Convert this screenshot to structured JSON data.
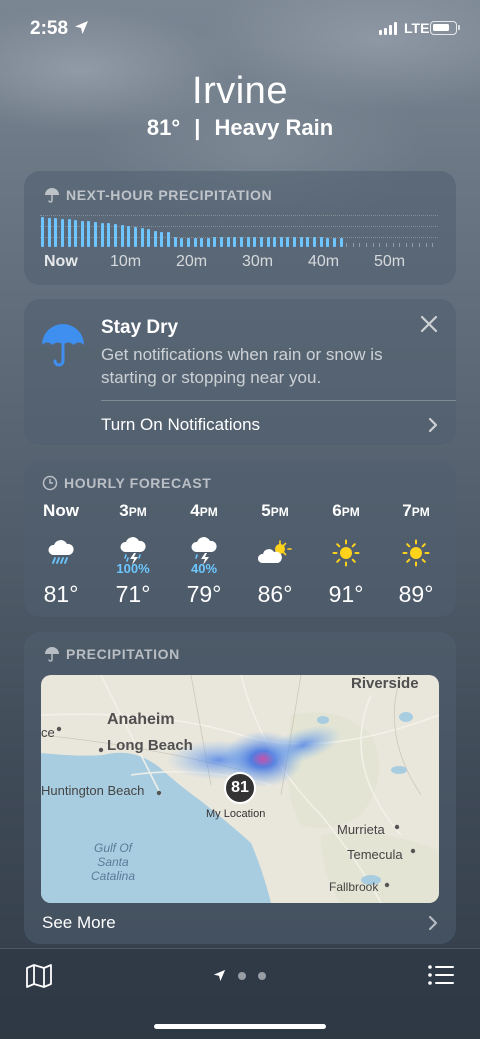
{
  "status": {
    "time": "2:58",
    "network": "LTE",
    "signal_bars": 4
  },
  "header": {
    "city": "Irvine",
    "temperature": "81°",
    "separator": "|",
    "condition": "Heavy Rain"
  },
  "precipitation_next_hour": {
    "title": "NEXT-HOUR PRECIPITATION",
    "axis_labels": [
      "Now",
      "10m",
      "20m",
      "30m",
      "40m",
      "50m"
    ],
    "chart_data": {
      "type": "bar",
      "x": [
        0,
        1,
        2,
        3,
        4,
        5,
        6,
        7,
        8,
        9,
        10,
        11,
        12,
        13,
        14,
        15,
        16,
        17,
        18,
        19,
        20,
        21,
        22,
        23,
        24,
        25,
        26,
        27,
        28,
        29,
        30,
        31,
        32,
        33,
        34,
        35,
        36,
        37,
        38,
        39,
        40,
        41,
        42,
        43,
        44,
        45,
        46,
        47,
        48,
        49,
        50,
        51,
        52,
        53,
        54,
        55,
        56,
        57,
        58,
        59
      ],
      "values": [
        0.95,
        0.92,
        0.9,
        0.88,
        0.86,
        0.84,
        0.82,
        0.8,
        0.78,
        0.76,
        0.74,
        0.72,
        0.68,
        0.65,
        0.62,
        0.58,
        0.55,
        0.5,
        0.48,
        0.46,
        0.3,
        0.28,
        0.28,
        0.28,
        0.29,
        0.29,
        0.3,
        0.3,
        0.3,
        0.3,
        0.3,
        0.3,
        0.3,
        0.3,
        0.3,
        0.31,
        0.31,
        0.31,
        0.31,
        0.3,
        0.3,
        0.3,
        0.3,
        0.29,
        0.28,
        0.28,
        0,
        0,
        0,
        0,
        0,
        0,
        0,
        0,
        0,
        0,
        0,
        0,
        0,
        0
      ],
      "ylim": [
        0,
        1
      ],
      "xlabel": "",
      "ylabel": ""
    }
  },
  "notification_card": {
    "title": "Stay Dry",
    "body": "Get notifications when rain or snow is starting or stopping near you.",
    "link": "Turn On Notifications"
  },
  "hourly": {
    "title": "HOURLY FORECAST",
    "items": [
      {
        "time": "Now",
        "suffix": "",
        "icon": "rain-icon",
        "pop": "",
        "temp": "81°"
      },
      {
        "time": "3",
        "suffix": "PM",
        "icon": "thunderstorm-icon",
        "pop": "100%",
        "temp": "71°"
      },
      {
        "time": "4",
        "suffix": "PM",
        "icon": "thunderstorm-icon",
        "pop": "40%",
        "temp": "79°"
      },
      {
        "time": "5",
        "suffix": "PM",
        "icon": "partly-sunny-icon",
        "pop": "",
        "temp": "86°"
      },
      {
        "time": "6",
        "suffix": "PM",
        "icon": "sun-icon",
        "pop": "",
        "temp": "91°"
      },
      {
        "time": "7",
        "suffix": "PM",
        "icon": "sun-icon",
        "pop": "",
        "temp": "89°"
      }
    ]
  },
  "precipitation_map": {
    "title": "PRECIPITATION",
    "labels": [
      "Riverside",
      "Anaheim",
      "Long Beach",
      "Huntington Beach",
      "Murrieta",
      "Temecula",
      "Fallbrook",
      "Gulf Of Santa Catalina",
      "ce"
    ],
    "location_temp": "81",
    "location_label": "My Location",
    "see_more": "See More"
  },
  "colors": {
    "precip_bar": "#6fc6ff",
    "pop_text": "#6cc7ff",
    "umbrella": "#3e8ff0",
    "sun": "#ffd21c"
  }
}
